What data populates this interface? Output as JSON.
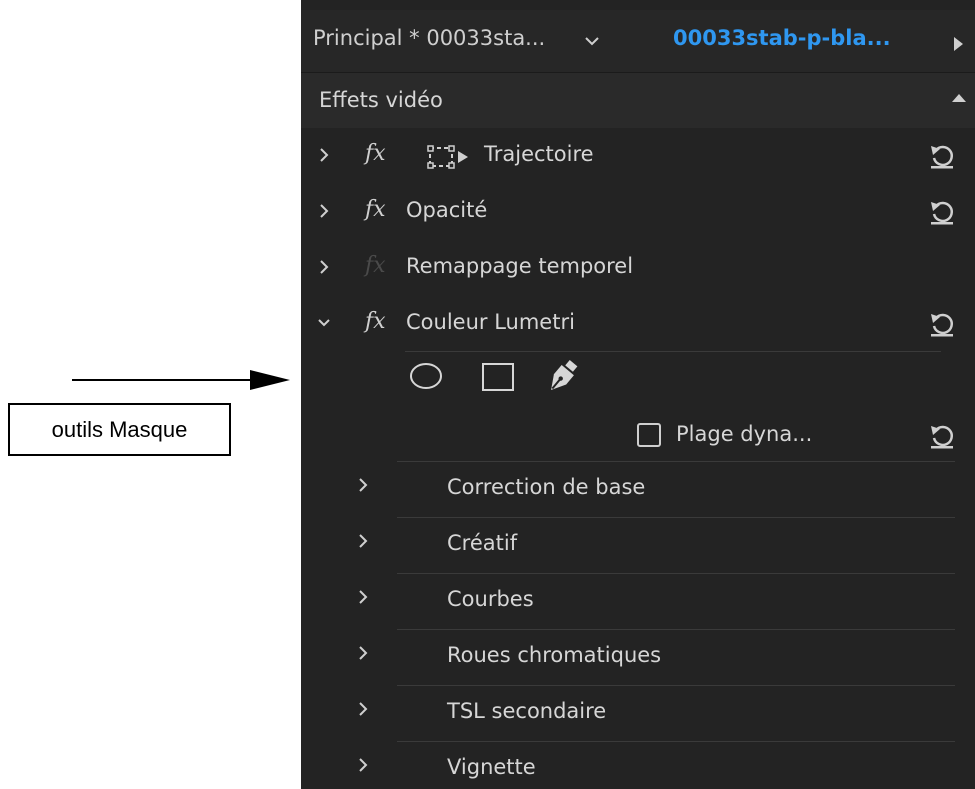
{
  "annotation": {
    "label": "outils Masque"
  },
  "tabs": {
    "master_label": "Principal * 00033sta...",
    "clip_label": "00033stab-p-bla..."
  },
  "section": {
    "title": "Effets vidéo"
  },
  "effects": [
    {
      "fx": "fx",
      "label": "Trajectoire",
      "expanded": false,
      "enabled": true
    },
    {
      "fx": "fx",
      "label": "Opacité",
      "expanded": false,
      "enabled": true
    },
    {
      "fx": "fx",
      "label": "Remappage temporel",
      "expanded": false,
      "enabled": false
    },
    {
      "fx": "fx",
      "label": "Couleur Lumetri",
      "expanded": true,
      "enabled": true
    }
  ],
  "lumetri": {
    "mask_tools": [
      "ellipse-mask-icon",
      "rectangle-mask-icon",
      "pen-mask-icon"
    ],
    "hdr_label": "Plage dyna...",
    "hdr_checked": false,
    "subsections": [
      "Correction de base",
      "Créatif",
      "Courbes",
      "Roues chromatiques",
      "TSL secondaire",
      "Vignette"
    ]
  },
  "colors": {
    "panel_bg": "#232323",
    "active_tab": "#2f97f0",
    "text": "#d6d6d6"
  }
}
